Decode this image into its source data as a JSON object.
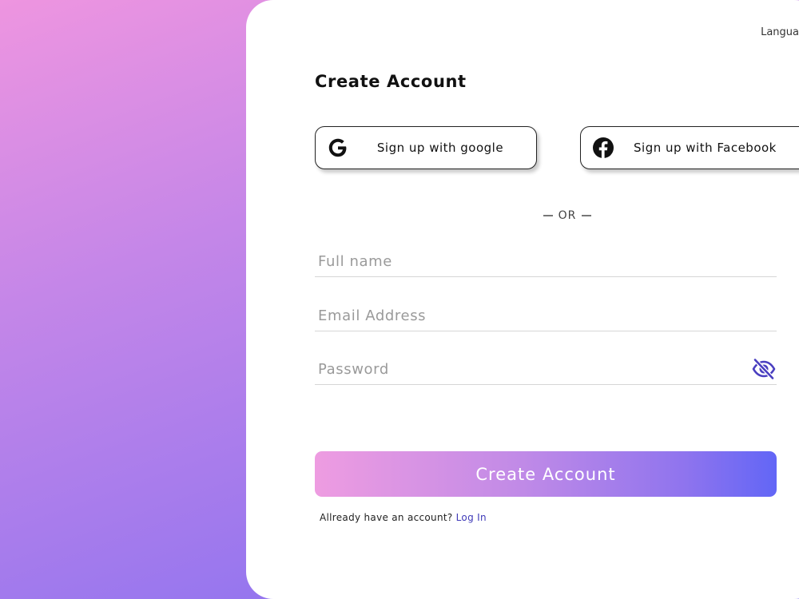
{
  "header": {
    "language_label": "Langua"
  },
  "form": {
    "title": "Create Account",
    "google_button": "Sign up with google",
    "facebook_button": "Sign up with Facebook",
    "divider_text": "OR",
    "full_name_placeholder": "Full name",
    "email_placeholder": "Email Address",
    "password_placeholder": "Password",
    "submit_label": "Create Account",
    "login_prompt": "Allready have an account?",
    "login_link": "Log In"
  },
  "icons": {
    "google": "google-icon",
    "facebook": "facebook-icon",
    "password_toggle": "eye-slash-icon"
  },
  "colors": {
    "accent_start": "#ee9ce1",
    "accent_end": "#6266f6",
    "eye_icon": "#4a3fc0",
    "link": "#3f3ab8"
  }
}
